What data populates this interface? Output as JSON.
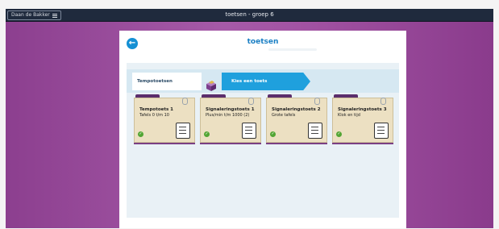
{
  "header": {
    "user_label": "Daan de Bakker",
    "window_title": "toetsen - groep 6"
  },
  "panel": {
    "title": "toetsen"
  },
  "tabs": {
    "tempo_label": "Tempotoetsen",
    "active_label": "Kies een toets"
  },
  "cards": [
    {
      "name": "Tempotoets 1",
      "desc": "Tafels 0 t/m 10"
    },
    {
      "name": "Signaleringstoets 1",
      "desc": "Plus/min t/m 1000 (2)"
    },
    {
      "name": "Signaleringstoets 2",
      "desc": "Grote tafels"
    },
    {
      "name": "Signaleringstoets 3",
      "desc": "Klok en tijd"
    }
  ],
  "colors": {
    "background": "#9a4c9c",
    "topbar": "#1f2a3d",
    "accent_blue": "#1fa0dd",
    "card": "#ece0c2",
    "check_green": "#52a534"
  }
}
